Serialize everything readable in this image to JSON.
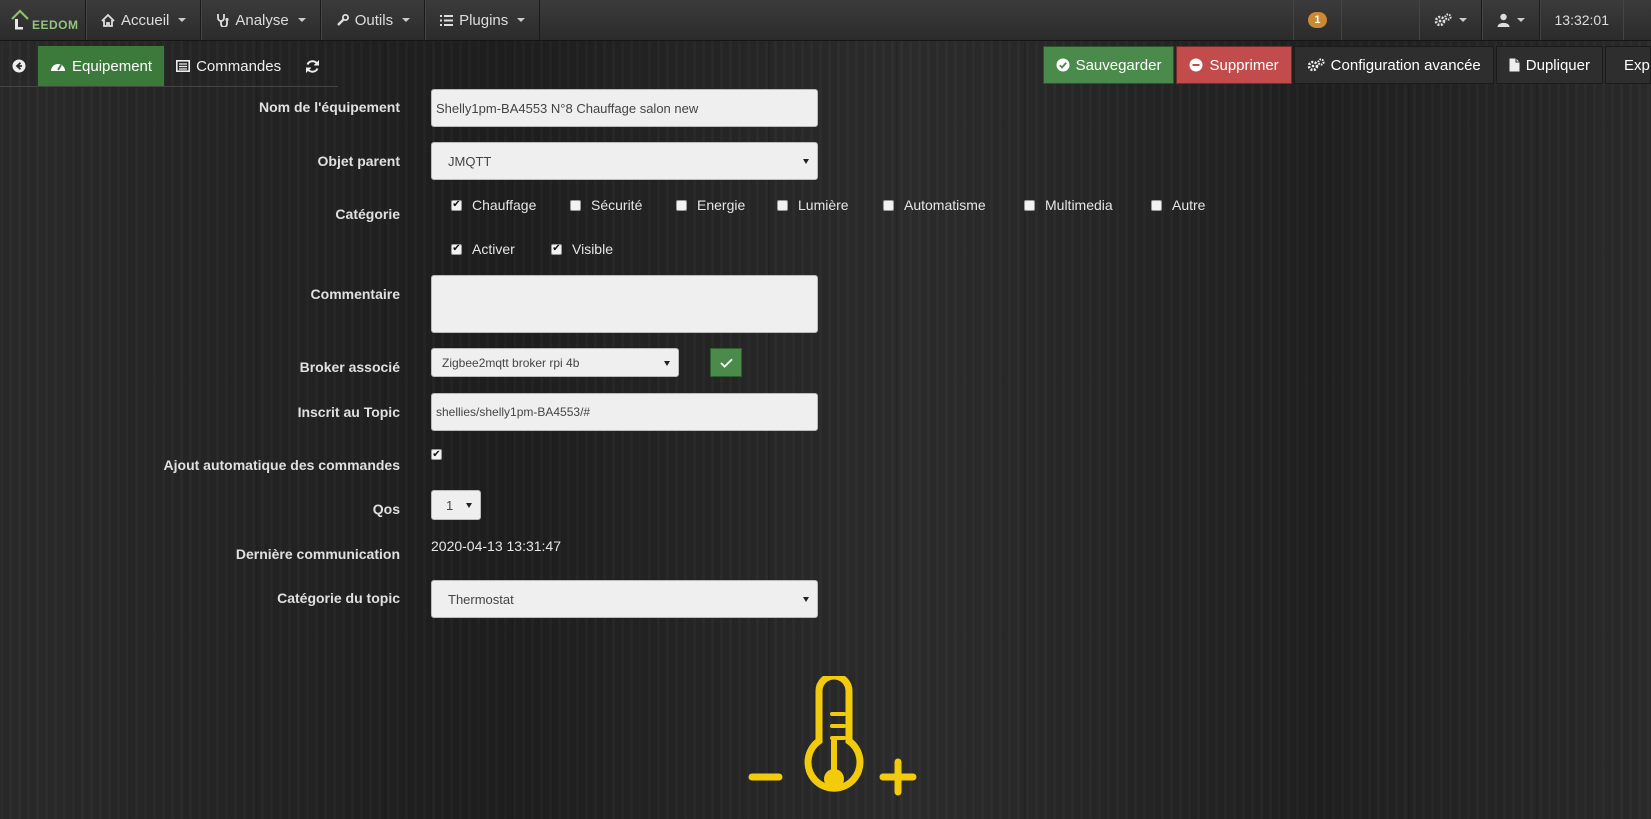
{
  "navbar": {
    "brand": "EEDOM",
    "menu": [
      {
        "label": "Accueil",
        "icon": "home-icon"
      },
      {
        "label": "Analyse",
        "icon": "stethoscope-icon"
      },
      {
        "label": "Outils",
        "icon": "wrench-icon"
      },
      {
        "label": "Plugins",
        "icon": "list-icon"
      }
    ],
    "badge": "1",
    "time": "13:32:01"
  },
  "tabs": {
    "equipement": "Equipement",
    "commandes": "Commandes"
  },
  "actions": {
    "save": "Sauvegarder",
    "delete": "Supprimer",
    "advanced": "Configuration avancée",
    "duplicate": "Dupliquer",
    "export": "Expo"
  },
  "form": {
    "name_label": "Nom de l'équipement",
    "name_value": "Shelly1pm-BA4553 N°8 Chauffage salon new",
    "parent_label": "Objet parent",
    "parent_value": "JMQTT",
    "category_label": "Catégorie",
    "categories": [
      {
        "label": "Chauffage",
        "checked": true
      },
      {
        "label": "Sécurité",
        "checked": false
      },
      {
        "label": "Energie",
        "checked": false
      },
      {
        "label": "Lumière",
        "checked": false
      },
      {
        "label": "Automatisme",
        "checked": false
      },
      {
        "label": "Multimedia",
        "checked": false
      },
      {
        "label": "Autre",
        "checked": false
      }
    ],
    "activer": "Activer",
    "visible": "Visible",
    "comment_label": "Commentaire",
    "broker_label": "Broker associé",
    "broker_value": "Zigbee2mqtt broker rpi 4b",
    "topic_label": "Inscrit au Topic",
    "topic_value": "shellies/shelly1pm-BA4553/#",
    "auto_label": "Ajout automatique des commandes",
    "qos_label": "Qos",
    "qos_value": "1",
    "lastcomm_label": "Dernière communication",
    "lastcomm_value": "2020-04-13 13:31:47",
    "topic_cat_label": "Catégorie du topic",
    "topic_cat_value": "Thermostat"
  },
  "colors": {
    "accent_green": "#4a8a4a",
    "danger_red": "#c24c4c",
    "thermostat_yellow": "#f2cc0c"
  }
}
